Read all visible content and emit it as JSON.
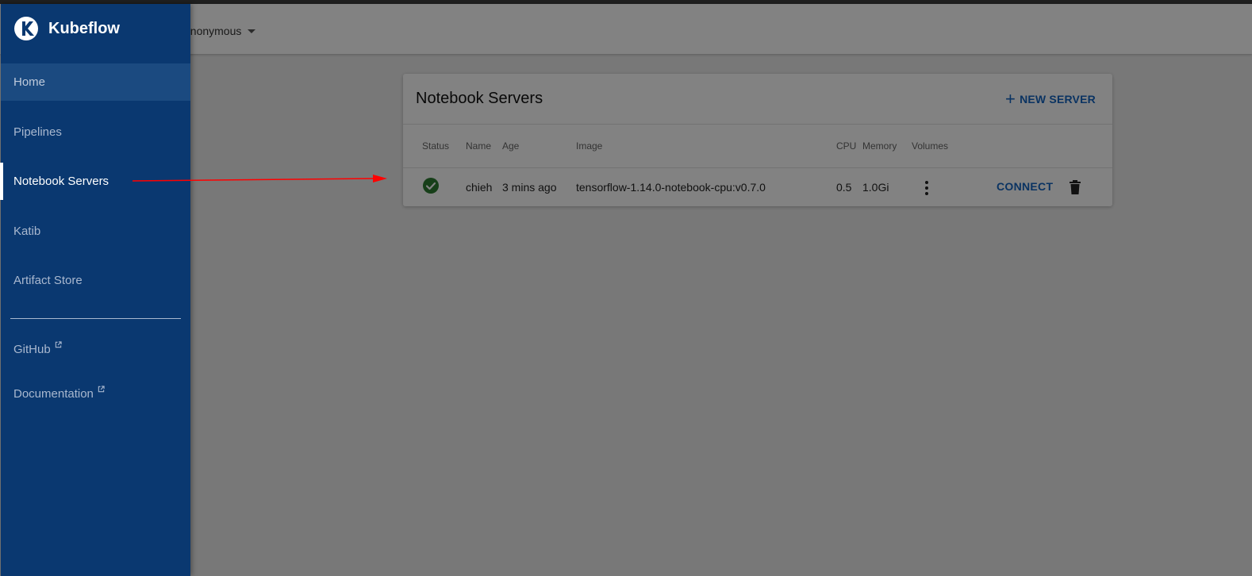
{
  "header": {
    "namespace": "anonymous"
  },
  "card": {
    "title": "Notebook Servers",
    "new_server_label": "NEW SERVER",
    "columns": [
      "Status",
      "Name",
      "Age",
      "Image",
      "CPU",
      "Memory",
      "Volumes"
    ],
    "rows": [
      {
        "status": "ready",
        "name": "chieh",
        "age": "3 mins ago",
        "image": "tensorflow-1.14.0-notebook-cpu:v0.7.0",
        "cpu": "0.5",
        "memory": "1.0Gi",
        "connect_label": "CONNECT"
      }
    ]
  },
  "sidebar": {
    "brand": "Kubeflow",
    "items": [
      {
        "label": "Home"
      },
      {
        "label": "Pipelines"
      },
      {
        "label": "Notebook Servers"
      },
      {
        "label": "Katib"
      },
      {
        "label": "Artifact Store"
      }
    ],
    "links": [
      {
        "label": "GitHub"
      },
      {
        "label": "Documentation"
      }
    ]
  },
  "colors": {
    "sidebar": "#0a3870",
    "accent": "#1565c0",
    "status_ok": "#2e7d32",
    "annotation_arrow": "#ff0000"
  }
}
